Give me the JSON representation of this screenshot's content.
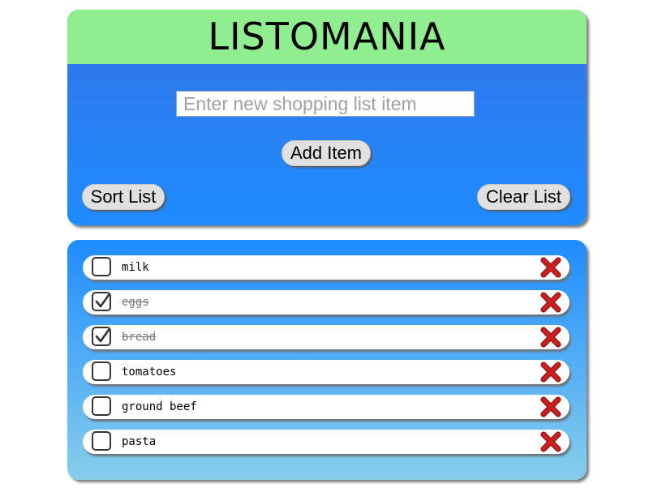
{
  "header": {
    "title": "LISTOMANIA"
  },
  "input": {
    "value": "",
    "placeholder": "Enter new shopping list item"
  },
  "buttons": {
    "add": "Add Item",
    "sort": "Sort List",
    "clear": "Clear List"
  },
  "list": {
    "items": [
      {
        "label": "milk",
        "checked": false
      },
      {
        "label": "eggs",
        "checked": true
      },
      {
        "label": "bread",
        "checked": true
      },
      {
        "label": "tomatoes",
        "checked": false
      },
      {
        "label": "ground beef",
        "checked": false
      },
      {
        "label": "pasta",
        "checked": false
      }
    ]
  },
  "icons": {
    "checkbox_check": "check-icon",
    "delete": "close-x-icon"
  },
  "colors": {
    "header_bg": "#90ee90",
    "panel_top": "#3273e6",
    "panel_bottom": "#1e8cff",
    "list_top": "#1e8cff",
    "list_bottom": "#87ceeb",
    "delete_x": "#cc1f1f"
  }
}
